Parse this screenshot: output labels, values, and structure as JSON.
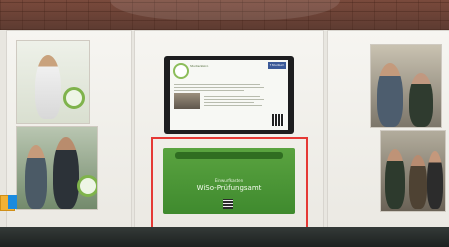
{
  "display": {
    "title": "Studienbüro",
    "social_label": "f Studium"
  },
  "collection_box": {
    "heading": "Einwurfkasten",
    "label": "WiSo-Prüfungsamt"
  },
  "colors": {
    "highlight": "#e53935",
    "box_green": "#4b972f",
    "accent": "#7fb34c"
  }
}
